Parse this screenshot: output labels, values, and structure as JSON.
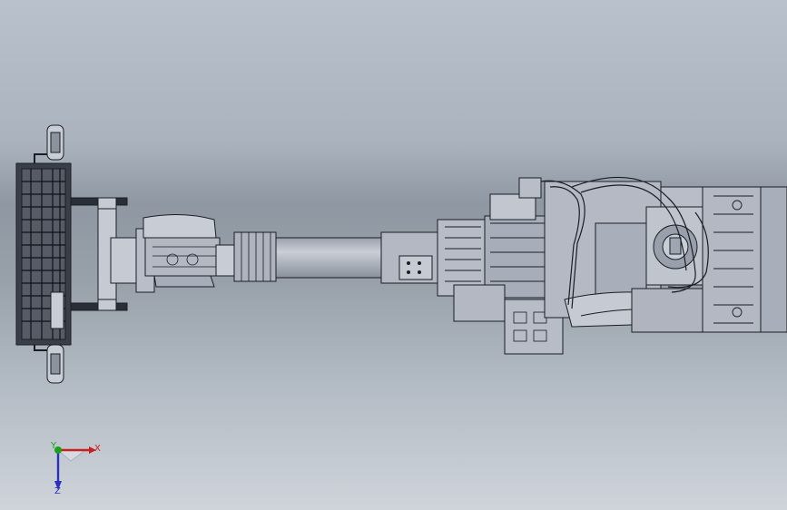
{
  "viewport": {
    "background_top": "#b9c2cc",
    "background_mid": "#8f98a2",
    "background_bottom": "#cfd4da"
  },
  "model": {
    "part_fill": "#b7bcc6",
    "part_shade": "#9aa0ab",
    "edge_color": "#1a1d24"
  },
  "triad": {
    "x_label": "X",
    "y_label": "Y",
    "z_label": "Z",
    "x_color": "#c8201e",
    "y_color": "#1aa01a",
    "z_color": "#2a2fc0"
  }
}
